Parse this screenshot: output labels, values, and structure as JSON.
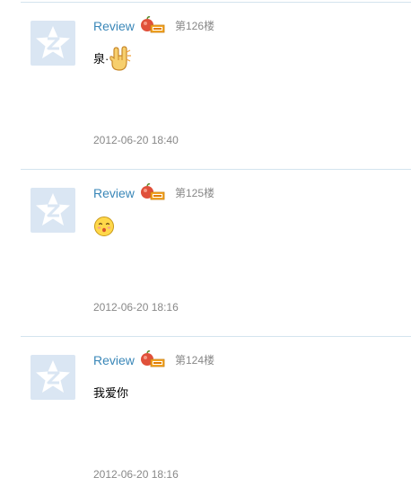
{
  "posts": [
    {
      "username": "Review",
      "floor": "第126楼",
      "content_text": "泉·",
      "content_emoji": "rock-hand-emoji",
      "timestamp": "2012-06-20 18:40"
    },
    {
      "username": "Review",
      "floor": "第125楼",
      "content_text": "",
      "content_emoji": "kiss-face-emoji",
      "timestamp": "2012-06-20 18:16"
    },
    {
      "username": "Review",
      "floor": "第124楼",
      "content_text": "我爱你",
      "content_emoji": "",
      "timestamp": "2012-06-20 18:16"
    }
  ],
  "colors": {
    "username": "#3a87b8",
    "meta": "#888888",
    "divider": "#d4e4ee",
    "avatar_bg": "#dae6f3"
  }
}
